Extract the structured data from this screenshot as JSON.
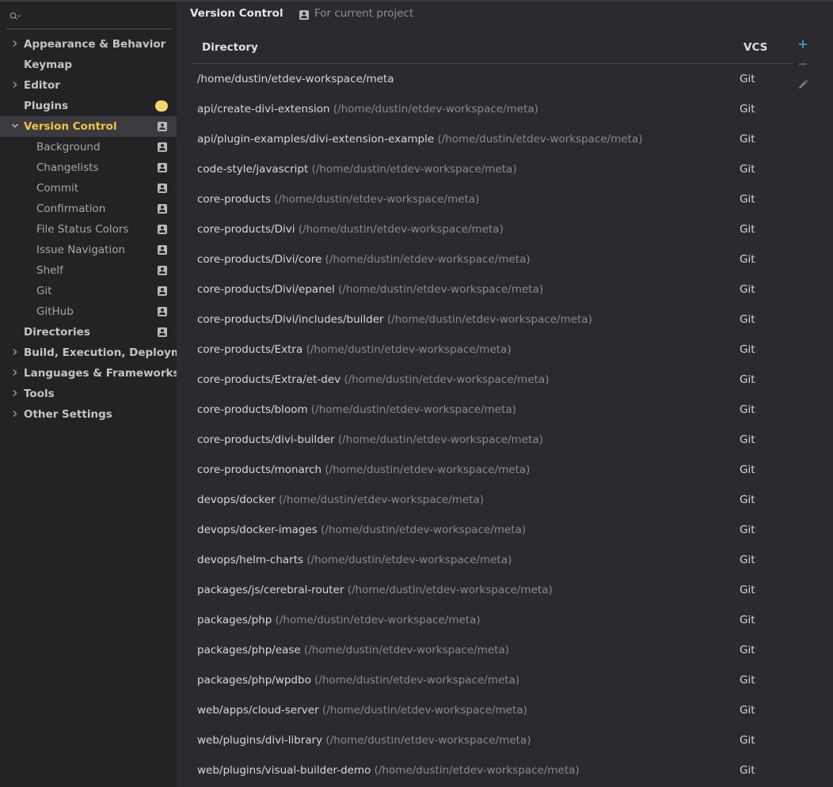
{
  "search": {
    "value": ""
  },
  "sidebar": {
    "items": [
      {
        "label": "Appearance & Behavior",
        "level": "top",
        "expandable": true,
        "expanded": false,
        "project_icon": false
      },
      {
        "label": "Keymap",
        "level": "top",
        "expandable": false,
        "project_icon": false
      },
      {
        "label": "Editor",
        "level": "top",
        "expandable": true,
        "expanded": false,
        "project_icon": false
      },
      {
        "label": "Plugins",
        "level": "top",
        "expandable": false,
        "project_icon": false,
        "badge": "update-dot"
      },
      {
        "label": "Version Control",
        "level": "top",
        "expandable": true,
        "expanded": true,
        "selected": true,
        "project_icon": true
      },
      {
        "label": "Background",
        "level": "child",
        "project_icon": true
      },
      {
        "label": "Changelists",
        "level": "child",
        "project_icon": true
      },
      {
        "label": "Commit",
        "level": "child",
        "project_icon": true
      },
      {
        "label": "Confirmation",
        "level": "child",
        "project_icon": true
      },
      {
        "label": "File Status Colors",
        "level": "child",
        "project_icon": true
      },
      {
        "label": "Issue Navigation",
        "level": "child",
        "project_icon": true
      },
      {
        "label": "Shelf",
        "level": "child",
        "project_icon": true
      },
      {
        "label": "Git",
        "level": "child",
        "project_icon": true
      },
      {
        "label": "GitHub",
        "level": "child",
        "project_icon": true
      },
      {
        "label": "Directories",
        "level": "top",
        "expandable": false,
        "project_icon": true
      },
      {
        "label": "Build, Execution, Deployment",
        "level": "top",
        "expandable": true,
        "expanded": false,
        "project_icon": false
      },
      {
        "label": "Languages & Frameworks",
        "level": "top",
        "expandable": true,
        "expanded": false,
        "project_icon": false
      },
      {
        "label": "Tools",
        "level": "top",
        "expandable": true,
        "expanded": false,
        "project_icon": false
      },
      {
        "label": "Other Settings",
        "level": "top",
        "expandable": true,
        "expanded": false,
        "project_icon": false
      }
    ]
  },
  "header": {
    "title": "Version Control",
    "scope": "For current project"
  },
  "table": {
    "columns": [
      "Directory",
      "VCS"
    ],
    "rows": [
      {
        "dir": "/home/dustin/etdev-workspace/meta",
        "path": "",
        "vcs": "Git"
      },
      {
        "dir": "api/create-divi-extension",
        "path": "(/home/dustin/etdev-workspace/meta)",
        "vcs": "Git"
      },
      {
        "dir": "api/plugin-examples/divi-extension-example",
        "path": "(/home/dustin/etdev-workspace/meta)",
        "vcs": "Git"
      },
      {
        "dir": "code-style/javascript",
        "path": "(/home/dustin/etdev-workspace/meta)",
        "vcs": "Git"
      },
      {
        "dir": "core-products",
        "path": "(/home/dustin/etdev-workspace/meta)",
        "vcs": "Git"
      },
      {
        "dir": "core-products/Divi",
        "path": "(/home/dustin/etdev-workspace/meta)",
        "vcs": "Git"
      },
      {
        "dir": "core-products/Divi/core",
        "path": "(/home/dustin/etdev-workspace/meta)",
        "vcs": "Git"
      },
      {
        "dir": "core-products/Divi/epanel",
        "path": "(/home/dustin/etdev-workspace/meta)",
        "vcs": "Git"
      },
      {
        "dir": "core-products/Divi/includes/builder",
        "path": "(/home/dustin/etdev-workspace/meta)",
        "vcs": "Git"
      },
      {
        "dir": "core-products/Extra",
        "path": "(/home/dustin/etdev-workspace/meta)",
        "vcs": "Git"
      },
      {
        "dir": "core-products/Extra/et-dev",
        "path": "(/home/dustin/etdev-workspace/meta)",
        "vcs": "Git"
      },
      {
        "dir": "core-products/bloom",
        "path": "(/home/dustin/etdev-workspace/meta)",
        "vcs": "Git"
      },
      {
        "dir": "core-products/divi-builder",
        "path": "(/home/dustin/etdev-workspace/meta)",
        "vcs": "Git"
      },
      {
        "dir": "core-products/monarch",
        "path": "(/home/dustin/etdev-workspace/meta)",
        "vcs": "Git"
      },
      {
        "dir": "devops/docker",
        "path": "(/home/dustin/etdev-workspace/meta)",
        "vcs": "Git"
      },
      {
        "dir": "devops/docker-images",
        "path": "(/home/dustin/etdev-workspace/meta)",
        "vcs": "Git"
      },
      {
        "dir": "devops/helm-charts",
        "path": "(/home/dustin/etdev-workspace/meta)",
        "vcs": "Git"
      },
      {
        "dir": "packages/js/cerebral-router",
        "path": "(/home/dustin/etdev-workspace/meta)",
        "vcs": "Git"
      },
      {
        "dir": "packages/php",
        "path": "(/home/dustin/etdev-workspace/meta)",
        "vcs": "Git"
      },
      {
        "dir": "packages/php/ease",
        "path": "(/home/dustin/etdev-workspace/meta)",
        "vcs": "Git"
      },
      {
        "dir": "packages/php/wpdbo",
        "path": "(/home/dustin/etdev-workspace/meta)",
        "vcs": "Git"
      },
      {
        "dir": "web/apps/cloud-server",
        "path": "(/home/dustin/etdev-workspace/meta)",
        "vcs": "Git"
      },
      {
        "dir": "web/plugins/divi-library",
        "path": "(/home/dustin/etdev-workspace/meta)",
        "vcs": "Git"
      },
      {
        "dir": "web/plugins/visual-builder-demo",
        "path": "(/home/dustin/etdev-workspace/meta)",
        "vcs": "Git"
      }
    ]
  },
  "toolbar": {
    "add_icon": "plus-icon",
    "remove_icon": "minus-icon",
    "edit_icon": "pencil-icon"
  },
  "colors": {
    "sidebar_bg": "#232326",
    "main_bg": "#2b2b2f",
    "selected_text": "#f5c342",
    "badge": "#f5d86d",
    "add_accent": "#3ea8de"
  }
}
